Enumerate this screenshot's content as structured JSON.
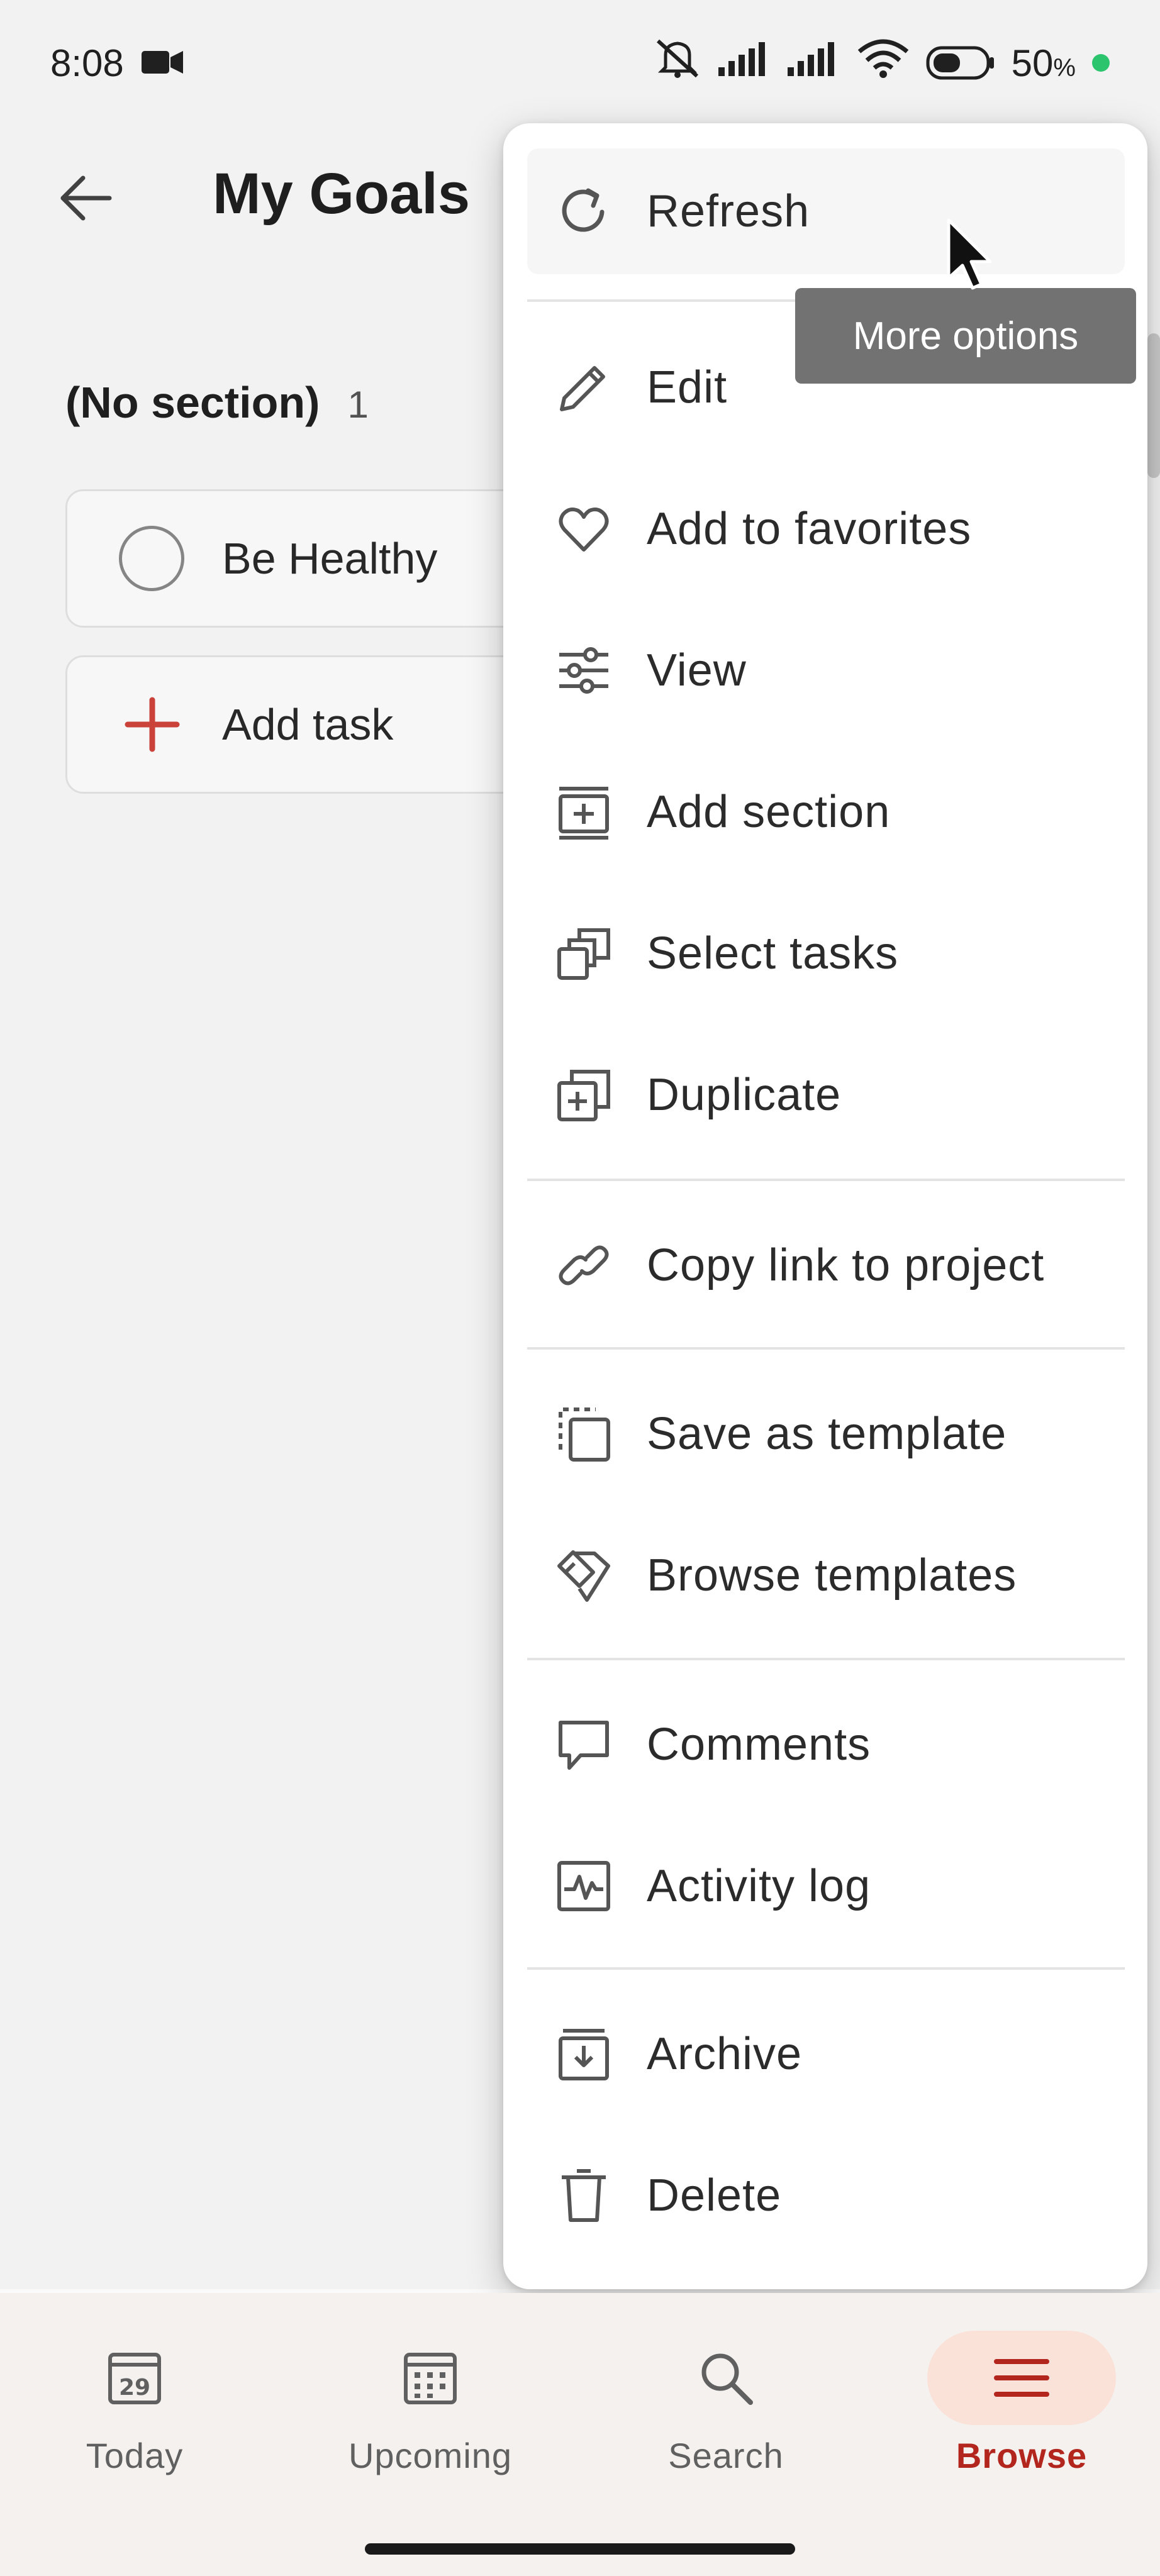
{
  "status_bar": {
    "time": "8:08",
    "battery_percent": "50",
    "battery_suffix": "%"
  },
  "header": {
    "title": "My Goals"
  },
  "section": {
    "name": "(No section)",
    "count": "1"
  },
  "tasks": [
    {
      "label": "Be Healthy"
    }
  ],
  "add_task_label": "Add task",
  "menu": {
    "items": [
      {
        "label": "Refresh",
        "icon": "refresh-icon"
      },
      {
        "label": "Edit",
        "icon": "pencil-icon"
      },
      {
        "label": "Add to favorites",
        "icon": "heart-icon"
      },
      {
        "label": "View",
        "icon": "sliders-icon"
      },
      {
        "label": "Add section",
        "icon": "add-section-icon"
      },
      {
        "label": "Select tasks",
        "icon": "select-tasks-icon"
      },
      {
        "label": "Duplicate",
        "icon": "duplicate-icon"
      },
      {
        "label": "Copy link to project",
        "icon": "link-icon"
      },
      {
        "label": "Save as template",
        "icon": "save-template-icon"
      },
      {
        "label": "Browse templates",
        "icon": "browse-templates-icon"
      },
      {
        "label": "Comments",
        "icon": "comment-icon"
      },
      {
        "label": "Activity log",
        "icon": "activity-icon"
      },
      {
        "label": "Archive",
        "icon": "archive-icon"
      },
      {
        "label": "Delete",
        "icon": "trash-icon"
      }
    ]
  },
  "tooltip": "More options",
  "bottom_nav": {
    "items": [
      {
        "label": "Today",
        "icon": "calendar-today-icon",
        "day": "29"
      },
      {
        "label": "Upcoming",
        "icon": "calendar-grid-icon"
      },
      {
        "label": "Search",
        "icon": "search-icon"
      },
      {
        "label": "Browse",
        "icon": "menu-icon",
        "active": true
      }
    ]
  },
  "colors": {
    "accent": "#b3261e",
    "active_pill": "#fbe2d8",
    "add_plus": "#d1453b",
    "tooltip_bg": "#727272"
  }
}
